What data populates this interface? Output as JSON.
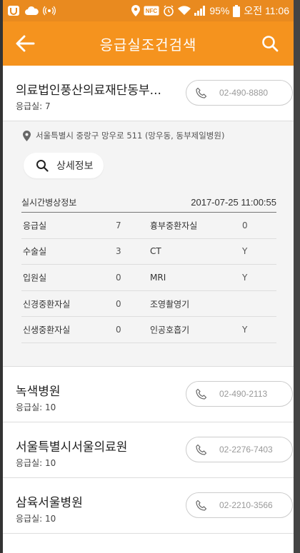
{
  "status_bar": {
    "battery": "95%",
    "time": "오전 11:06",
    "nfc": "NFC"
  },
  "app_bar": {
    "title": "응급실조건검색"
  },
  "hospitals": [
    {
      "name": "의료법인풍산의료재단동부...",
      "er": "응급실: 7",
      "phone": "02-490-8880"
    },
    {
      "name": "녹색병원",
      "er": "응급실: 10",
      "phone": "02-490-2113"
    },
    {
      "name": "서울특별시서울의료원",
      "er": "응급실: 10",
      "phone": "02-2276-7403"
    },
    {
      "name": "삼육서울병원",
      "er": "응급실: 10",
      "phone": "02-2210-3566"
    }
  ],
  "detail": {
    "address": "서울특별시 중랑구 망우로 511 (망우동, 동부제일병원)",
    "info_button": "상세정보",
    "realtime_label": "실시간병상정보",
    "timestamp": "2017-07-25 11:00:55",
    "rows": [
      {
        "k1": "응급실",
        "v1": "7",
        "k2": "흉부중환자실",
        "v2": "0"
      },
      {
        "k1": "수술실",
        "v1": "3",
        "k2": "CT",
        "v2": "Y"
      },
      {
        "k1": "입원실",
        "v1": "0",
        "k2": "MRI",
        "v2": "Y"
      },
      {
        "k1": "신경중환자실",
        "v1": "0",
        "k2": "조영촬영기",
        "v2": ""
      },
      {
        "k1": "신생중환자실",
        "v1": "0",
        "k2": "인공호흡기",
        "v2": "Y"
      }
    ]
  },
  "colors": {
    "status_bar": "#e98a1f",
    "app_bar": "#f5931e"
  }
}
